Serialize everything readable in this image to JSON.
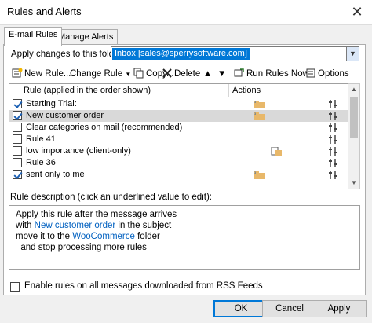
{
  "window": {
    "title": "Rules and Alerts",
    "close_glyph": "✕"
  },
  "tabs": [
    {
      "label": "E-mail Rules",
      "active": true
    },
    {
      "label": "Manage Alerts",
      "active": false
    }
  ],
  "folder": {
    "label": "Apply changes to this folder:",
    "value": "Inbox [sales@sperrysoftware.com]"
  },
  "toolbar": {
    "new_rule": "New Rule...",
    "change_rule": "Change Rule",
    "copy": "Copy...",
    "delete": "Delete",
    "run_rules": "Run Rules Now...",
    "options": "Options"
  },
  "list": {
    "header_rule": "Rule (applied in the order shown)",
    "header_actions": "Actions",
    "rows": [
      {
        "label": "Starting Trial:",
        "checked": true,
        "selected": false,
        "action1": "move-to-folder-icon",
        "action2": "rule-settings-icon"
      },
      {
        "label": "New customer order",
        "checked": true,
        "selected": true,
        "action1": "move-to-folder-icon",
        "action2": "rule-settings-icon"
      },
      {
        "label": "Clear categories on mail (recommended)",
        "checked": false,
        "selected": false,
        "action1": "",
        "action2": "rule-settings-icon"
      },
      {
        "label": "Rule 41",
        "checked": false,
        "selected": false,
        "action1": "",
        "action2": "rule-settings-icon"
      },
      {
        "label": "low importance  (client-only)",
        "checked": false,
        "selected": false,
        "action1": "copy-to-folder-icon",
        "action2": "rule-settings-icon"
      },
      {
        "label": "Rule 36",
        "checked": false,
        "selected": false,
        "action1": "",
        "action2": "rule-settings-icon"
      },
      {
        "label": "sent only to me",
        "checked": true,
        "selected": false,
        "action1": "move-to-folder-icon",
        "action2": "rule-settings-icon"
      }
    ]
  },
  "description": {
    "label": "Rule description (click an underlined value to edit):",
    "line1": "Apply this rule after the message arrives",
    "line2_pre": "with ",
    "line2_link": "New customer order",
    "line2_post": " in the subject",
    "line3_pre": "move it to the ",
    "line3_link": "WooCommerce",
    "line3_post": " folder",
    "line4": "  and stop processing more rules"
  },
  "rss": {
    "label": "Enable rules on all messages downloaded from RSS Feeds",
    "checked": false
  },
  "buttons": {
    "ok": "OK",
    "cancel": "Cancel",
    "apply": "Apply"
  },
  "colors": {
    "highlight": "#0078d7",
    "annotation": "#d9232b",
    "link": "#0060c0"
  }
}
